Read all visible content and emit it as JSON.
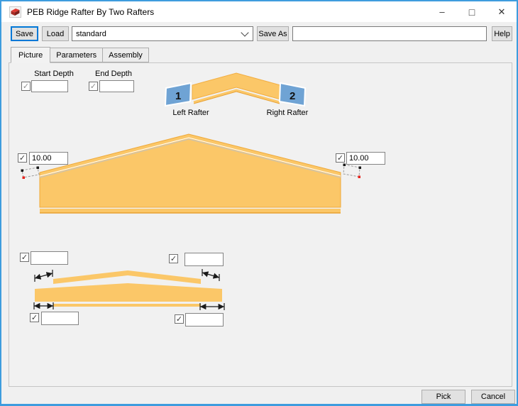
{
  "window": {
    "title": "PEB Ridge Rafter By Two Rafters"
  },
  "icons": {
    "check": "✓",
    "minimize": "–",
    "maximize": "□",
    "close": "✕"
  },
  "toolbar": {
    "save_label": "Save",
    "load_label": "Load",
    "preset_value": "standard",
    "save_as_label": "Save As",
    "save_as_value": "",
    "help_label": "Help"
  },
  "tabs": {
    "picture": "Picture",
    "parameters": "Parameters",
    "assembly": "Assembly"
  },
  "picture": {
    "start_depth_label": "Start Depth",
    "end_depth_label": "End Depth",
    "start_depth_value": "",
    "end_depth_value": "",
    "diagram": {
      "left_number": "1",
      "right_number": "2",
      "left_label": "Left Rafter",
      "right_label": "Right Rafter"
    },
    "main": {
      "left_value": "10.00",
      "right_value": "10.00"
    },
    "offsets": {
      "top_left": "",
      "top_right": "",
      "bottom_left": "",
      "bottom_right": ""
    }
  },
  "footer": {
    "pick_label": "Pick",
    "cancel_label": "Cancel"
  },
  "colors": {
    "accent_border": "#3E9CDE",
    "focus_blue": "#0078D7",
    "rafter_fill": "#FBC768",
    "rafter_edge": "#EFA939",
    "block_blue": "#6FA3D4"
  }
}
